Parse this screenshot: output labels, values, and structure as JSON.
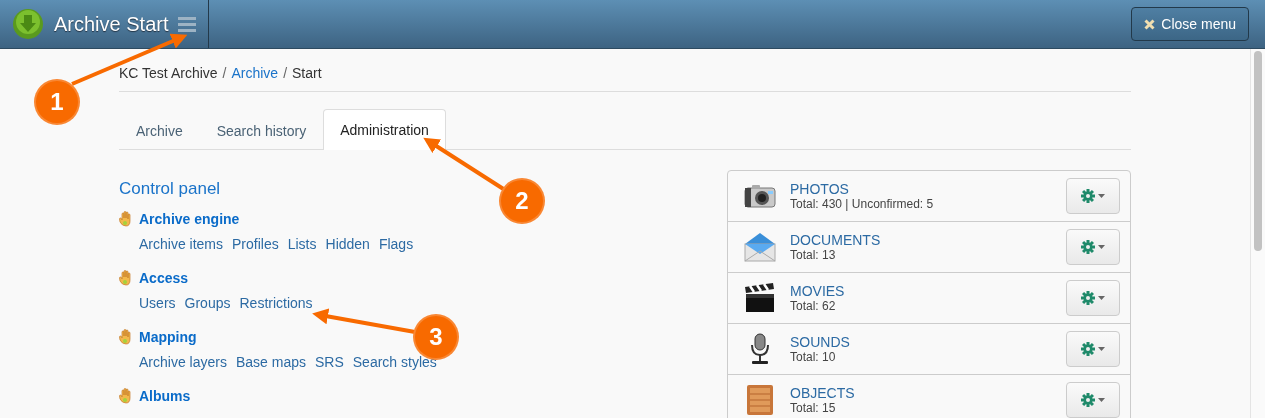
{
  "header": {
    "title": "Archive Start",
    "close_button": "Close menu"
  },
  "breadcrumb": {
    "separator": "/",
    "items": [
      {
        "label": "KC Test Archive",
        "link": false
      },
      {
        "label": "Archive",
        "link": true
      },
      {
        "label": "Start",
        "link": false
      }
    ]
  },
  "tabs": [
    {
      "label": "Archive",
      "selected": false
    },
    {
      "label": "Search history",
      "selected": false
    },
    {
      "label": "Administration",
      "selected": true
    }
  ],
  "control_panel": {
    "title": "Control panel",
    "sections": [
      {
        "title": "Archive engine",
        "links": [
          "Archive items",
          "Profiles",
          "Lists",
          "Hidden",
          "Flags"
        ]
      },
      {
        "title": "Access",
        "links": [
          "Users",
          "Groups",
          "Restrictions"
        ]
      },
      {
        "title": "Mapping",
        "links": [
          "Archive layers",
          "Base maps",
          "SRS",
          "Search styles"
        ]
      },
      {
        "title": "Albums"
      }
    ]
  },
  "collections": [
    {
      "kind": "camera",
      "name": "PHOTOS",
      "summary": "Total: 430 | Unconfirmed: 5"
    },
    {
      "kind": "envelope",
      "name": "DOCUMENTS",
      "summary": "Total: 13"
    },
    {
      "kind": "clapperboard",
      "name": "MOVIES",
      "summary": "Total: 62"
    },
    {
      "kind": "microphone",
      "name": "SOUNDS",
      "summary": "Total: 10"
    },
    {
      "kind": "crate",
      "name": "OBJECTS",
      "summary": "Total: 15"
    }
  ],
  "callouts": [
    {
      "number": "1"
    },
    {
      "number": "2"
    },
    {
      "number": "3"
    }
  ]
}
